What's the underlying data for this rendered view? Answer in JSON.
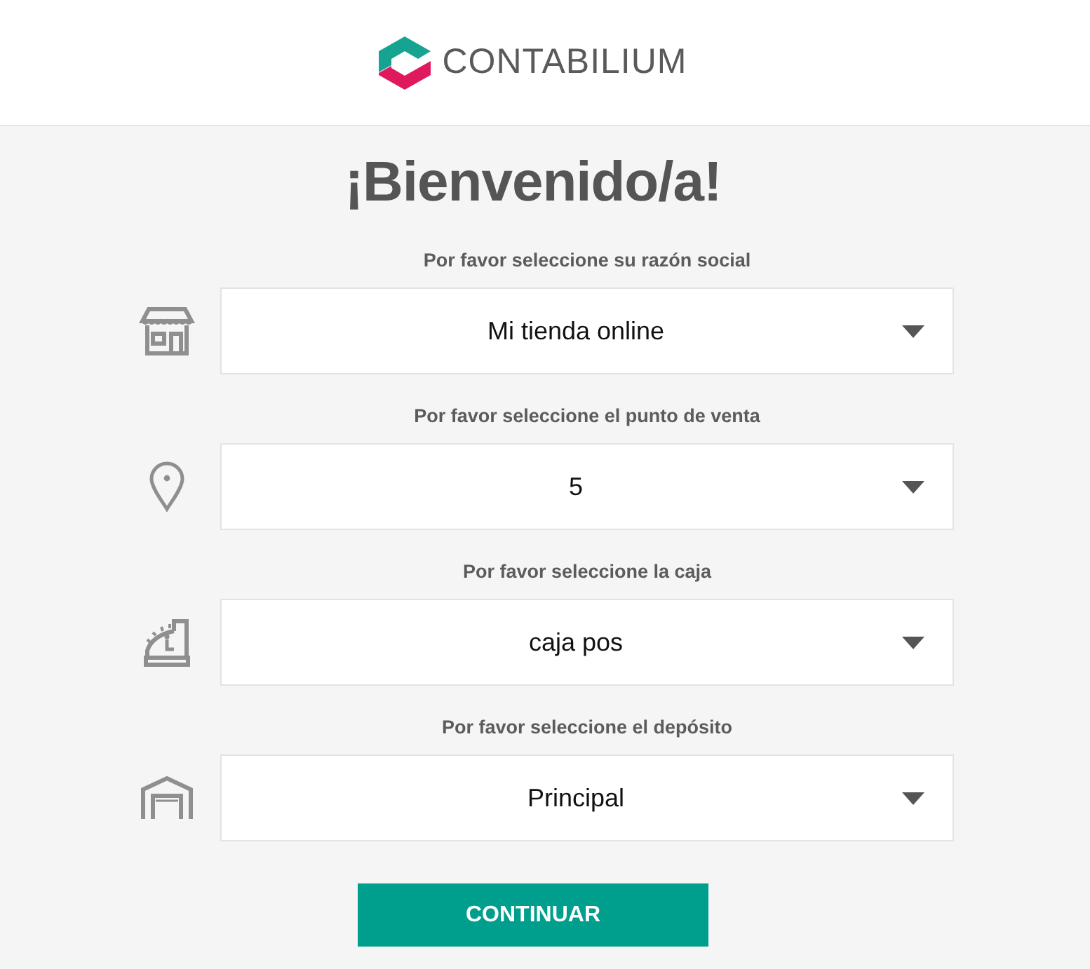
{
  "header": {
    "logo_text": "CONTABILIUM"
  },
  "title": "¡Bienvenido/a!",
  "fields": [
    {
      "kind": "store",
      "label": "Por favor seleccione su razón social",
      "value": "Mi tienda online"
    },
    {
      "kind": "location",
      "label": "Por favor seleccione el punto de venta",
      "value": "5"
    },
    {
      "kind": "register",
      "label": "Por favor seleccione la caja",
      "value": "caja pos"
    },
    {
      "kind": "warehouse",
      "label": "Por favor seleccione el depósito",
      "value": "Principal"
    }
  ],
  "button": "CONTINUAR"
}
